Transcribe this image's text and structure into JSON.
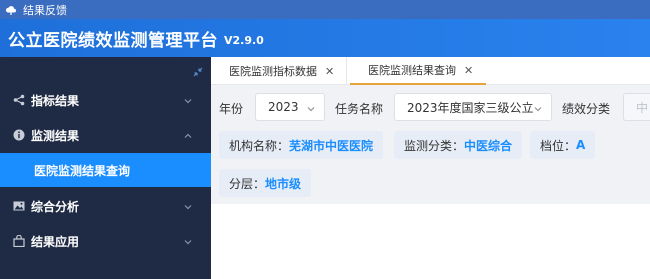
{
  "window": {
    "title": "结果反馈",
    "icon": "cloud-icon"
  },
  "header": {
    "title": "公立医院绩效监测管理平台",
    "version": "V2.9.0"
  },
  "sidebar": {
    "collapse_icon": "collapse-arrows-icon",
    "items": [
      {
        "label": "指标结果",
        "icon": "share-icon",
        "expanded": false
      },
      {
        "label": "监测结果",
        "icon": "info-circle-icon",
        "expanded": true,
        "children": [
          {
            "label": "医院监测结果查询",
            "active": true
          }
        ]
      },
      {
        "label": "综合分析",
        "icon": "image-icon",
        "expanded": false
      },
      {
        "label": "结果应用",
        "icon": "bag-icon",
        "expanded": false
      }
    ]
  },
  "tabs": [
    {
      "label": "医院监测指标数据",
      "active": false
    },
    {
      "label": "医院监测结果查询",
      "active": true
    }
  ],
  "filters": {
    "year_label": "年份",
    "year_value": "2023",
    "task_label": "任务名称",
    "task_value": "2023年度国家三级公立",
    "perf_label": "绩效分类",
    "perf_value": "中"
  },
  "tags": {
    "org_label": "机构名称：",
    "org_value": "芜湖市中医医院",
    "cat_label": "监测分类：",
    "cat_value": "中医综合",
    "grade_label": "档位：",
    "grade_value": "A",
    "tier_label": "分层：",
    "tier_value": "地市级"
  },
  "colors": {
    "header": "#1e6fd9",
    "sidebar": "#1f2b44",
    "active_menu": "#1a8dff",
    "tag_value": "#1a8dff",
    "active_tab": "#e8a33d"
  }
}
